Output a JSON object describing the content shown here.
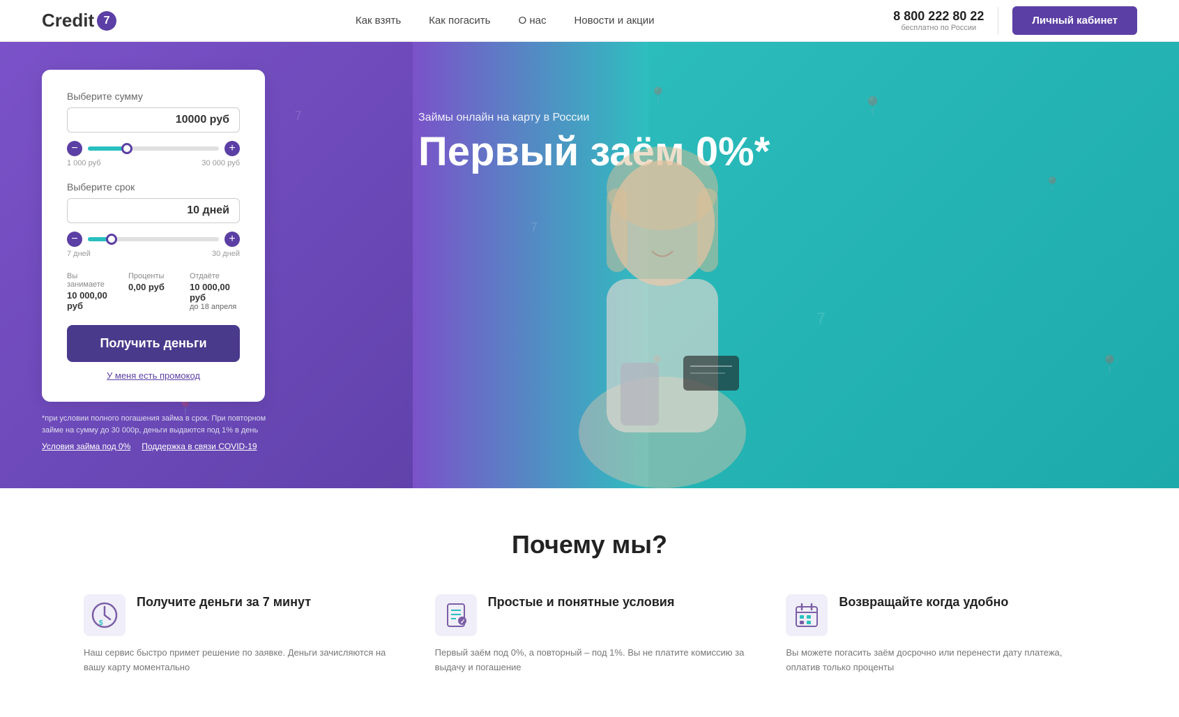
{
  "header": {
    "logo_text": "Credit",
    "logo_number": "7",
    "nav": [
      {
        "label": "Как взять",
        "href": "#"
      },
      {
        "label": "Как погасить",
        "href": "#"
      },
      {
        "label": "О нас",
        "href": "#"
      },
      {
        "label": "Новости и акции",
        "href": "#"
      }
    ],
    "phone": "8 800 222 80 22",
    "phone_sub": "бесплатно по России",
    "cabinet_btn": "Личный кабинет"
  },
  "hero": {
    "subtitle": "Займы онлайн на карту в России",
    "title": "Первый заём 0%*",
    "calc": {
      "amount_label": "Выберите сумму",
      "amount_value": "10000 руб",
      "amount_min": "1 000 руб",
      "amount_max": "30 000 руб",
      "amount_fill_pct": 30,
      "amount_thumb_pct": 30,
      "term_label": "Выберите срок",
      "term_value": "10 дней",
      "term_min": "7 дней",
      "term_max": "30 дней",
      "term_fill_pct": 18,
      "term_thumb_pct": 18,
      "borrow_label": "Вы занимаете",
      "borrow_value": "10 000,00 руб",
      "interest_label": "Проценты",
      "interest_value": "0,00 руб",
      "return_label": "Отдаёте",
      "return_value": "10 000,00 руб",
      "return_date": "до 18 апреля",
      "btn_label": "Получить деньги",
      "promo_label": "У меня есть промокод"
    },
    "disclaimer": "*при условии полного погашения займа в срок. При повторном займе на сумму до 30 000р, деньги выдаются под 1% в день",
    "link1": "Условия займа под 0%",
    "link2": "Поддержка в связи COVID-19"
  },
  "why": {
    "title": "Почему мы?",
    "cards": [
      {
        "icon": "⏱",
        "title": "Получите деньги за 7 минут",
        "text": "Наш сервис быстро примет решение по заявке. Деньги зачисляются на вашу карту моментально"
      },
      {
        "icon": "📄",
        "title": "Простые и понятные условия",
        "text": "Первый заём под 0%, а повторный – под 1%. Вы не платите комиссию за выдачу и погашение"
      },
      {
        "icon": "📅",
        "title": "Возвращайте когда удобно",
        "text": "Вы можете погасить заём досрочно или перенести дату платежа, оплатив только проценты"
      }
    ]
  }
}
